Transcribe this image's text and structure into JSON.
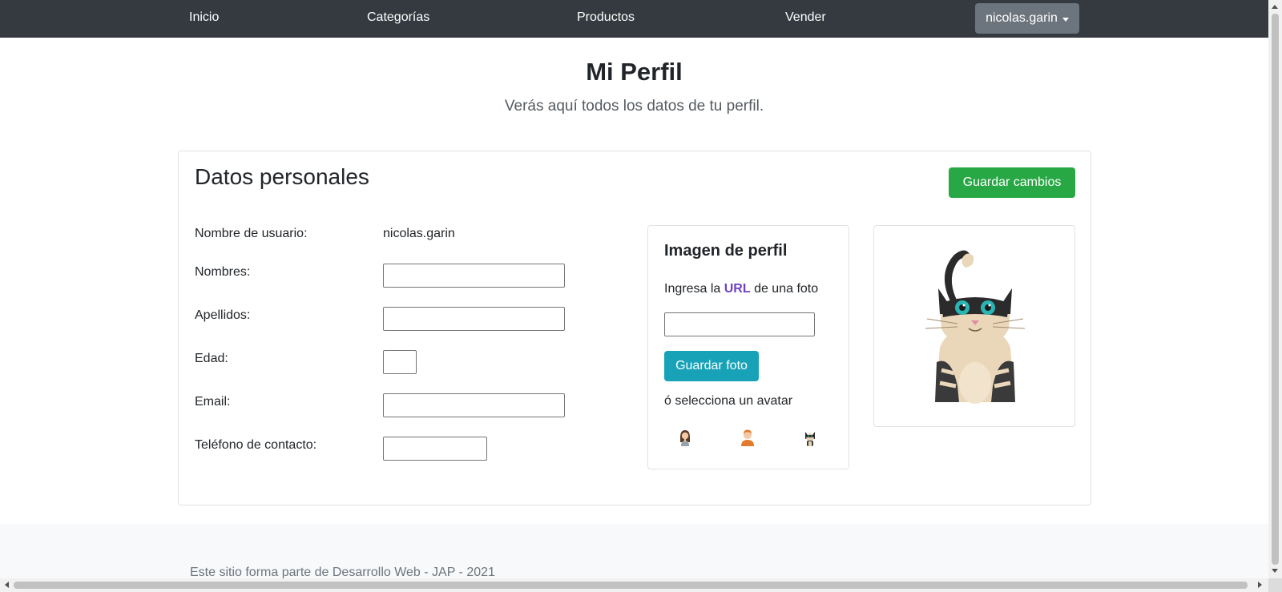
{
  "navbar": {
    "items": [
      {
        "label": "Inicio"
      },
      {
        "label": "Categorías"
      },
      {
        "label": "Productos"
      },
      {
        "label": "Vender"
      }
    ],
    "user_label": "nicolas.garin"
  },
  "header": {
    "title": "Mi Perfil",
    "subtitle": "Verás aquí todos los datos de tu perfil."
  },
  "personal": {
    "title": "Datos personales",
    "save_label": "Guardar cambios",
    "fields": {
      "username_label": "Nombre de usuario:",
      "username_value": "nicolas.garin",
      "names_label": "Nombres:",
      "names_value": "",
      "lastnames_label": "Apellidos:",
      "lastnames_value": "",
      "age_label": "Edad:",
      "age_value": "",
      "email_label": "Email:",
      "email_value": "",
      "phone_label": "Teléfono de contacto:",
      "phone_value": ""
    }
  },
  "profile_image": {
    "title": "Imagen de perfil",
    "hint_prefix": "Ingresa la",
    "hint_strong": "URL",
    "hint_suffix": "de una foto",
    "url_value": "",
    "save_photo_label": "Guardar foto",
    "avatar_hint": "ó selecciona un avatar",
    "avatars": [
      "woman-avatar-icon",
      "man-avatar-icon",
      "cat-avatar-icon"
    ],
    "preview": "cat-avatar-icon"
  },
  "footer": {
    "text": "Este sitio forma parte de Desarrollo Web - JAP - 2021"
  },
  "colors": {
    "navbar": "#343a40",
    "success": "#28a745",
    "info": "#17a2b8",
    "secondary": "#6c757d",
    "url_highlight": "#6f42c1"
  }
}
